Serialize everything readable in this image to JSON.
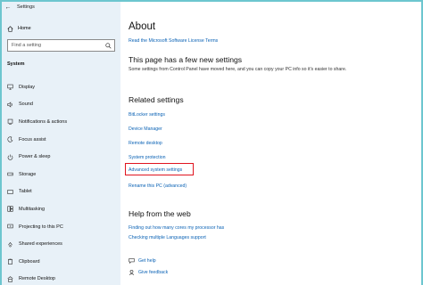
{
  "window": {
    "title": "Settings"
  },
  "sidebar": {
    "home_label": "Home",
    "search_placeholder": "Find a setting",
    "section_label": "System",
    "items": [
      {
        "label": "Display",
        "icon": "display-icon"
      },
      {
        "label": "Sound",
        "icon": "sound-icon"
      },
      {
        "label": "Notifications & actions",
        "icon": "notifications-icon"
      },
      {
        "label": "Focus assist",
        "icon": "focus-assist-icon"
      },
      {
        "label": "Power & sleep",
        "icon": "power-icon"
      },
      {
        "label": "Storage",
        "icon": "storage-icon"
      },
      {
        "label": "Tablet",
        "icon": "tablet-icon"
      },
      {
        "label": "Multitasking",
        "icon": "multitasking-icon"
      },
      {
        "label": "Projecting to this PC",
        "icon": "projecting-icon"
      },
      {
        "label": "Shared experiences",
        "icon": "shared-experiences-icon"
      },
      {
        "label": "Clipboard",
        "icon": "clipboard-icon"
      },
      {
        "label": "Remote Desktop",
        "icon": "remote-desktop-icon"
      }
    ]
  },
  "main": {
    "title": "About",
    "license_link": "Read the Microsoft Software License Terms",
    "new_settings_heading": "This page has a few new settings",
    "new_settings_text": "Some settings from Control Panel have moved here, and you can copy your PC info so it's easier to share.",
    "related_heading": "Related settings",
    "related_links": [
      "BitLocker settings",
      "Device Manager",
      "Remote desktop",
      "System protection",
      "Advanced system settings",
      "Rename this PC (advanced)"
    ],
    "help_heading": "Help from the web",
    "help_links": [
      "Finding out how many cores my processor has",
      "Checking multiple Languages support"
    ],
    "get_help": "Get help",
    "give_feedback": "Give feedback"
  },
  "colors": {
    "accent": "#0a62b5",
    "highlight": "#e0141f",
    "frame": "#6dc6cf",
    "sidebar_bg": "#e8f1f8"
  }
}
